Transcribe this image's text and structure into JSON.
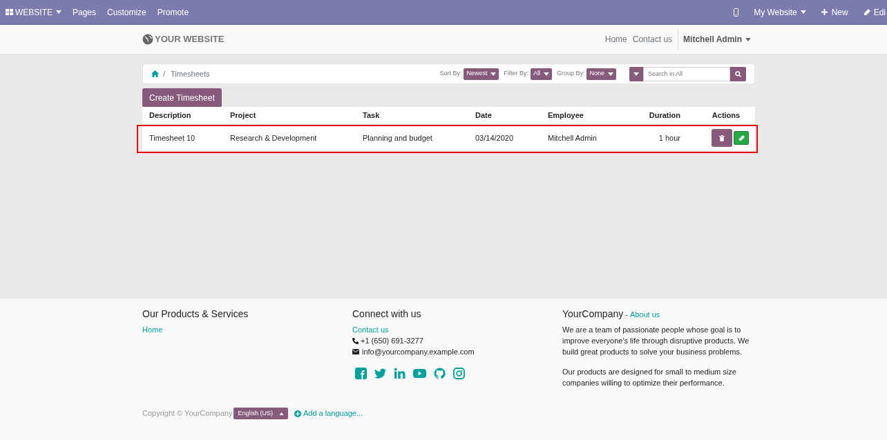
{
  "topbar": {
    "left": [
      {
        "kind": "apps",
        "label": "WEBSITE",
        "caret": true
      },
      {
        "kind": "link",
        "label": "Pages",
        "caret": false
      },
      {
        "kind": "link",
        "label": "Customize",
        "caret": false
      },
      {
        "kind": "link",
        "label": "Promote",
        "caret": false
      }
    ],
    "right": [
      {
        "kind": "mobile",
        "caret": false
      },
      {
        "kind": "link",
        "label": "My Website",
        "caret": true
      },
      {
        "kind": "plus",
        "label": "New",
        "caret": false
      },
      {
        "kind": "pencil",
        "label": "Edi",
        "caret": false
      }
    ]
  },
  "header": {
    "logo": "YOUR WEBSITE",
    "nav": [
      "Home",
      "Contact us"
    ],
    "user": "Mitchell Admin"
  },
  "breadcrumb": {
    "separator": "/",
    "current": "Timesheets"
  },
  "filters": [
    {
      "label": "Sort By:",
      "value": "Newest"
    },
    {
      "label": "Filter By:",
      "value": "All"
    },
    {
      "label": "Group By:",
      "value": "None"
    }
  ],
  "search": {
    "placeholder": "Search in All"
  },
  "create_button": "Create Timesheet",
  "table": {
    "columns": [
      "Description",
      "Project",
      "Task",
      "Date",
      "Employee",
      "Duration",
      "Actions"
    ],
    "rows": [
      {
        "cells": [
          "Timesheet 10",
          "Research & Development",
          "Planning and budget",
          "03/14/2020",
          "Mitchell Admin",
          "1 hour"
        ],
        "highlighted": true
      }
    ]
  },
  "footer": {
    "products": {
      "title": "Our Products & Services",
      "links": [
        "Home"
      ]
    },
    "connect": {
      "title": "Connect with us",
      "link": "Contact us",
      "phone": "+1 (650) 691-3277",
      "email": "info@yourcompany.example.com"
    },
    "about": {
      "title": "YourCompany",
      "separator": "-",
      "link": "About us",
      "paragraphs": [
        "We are a team of passionate people whose goal is to improve everyone's life through disruptive products. We build great products to solve your business problems.",
        "Our products are designed for small to medium size companies willing to optimize their performance."
      ]
    },
    "copyright": "Copyright © YourCompany",
    "language": "English (US)",
    "add_language": "Add a language..."
  }
}
